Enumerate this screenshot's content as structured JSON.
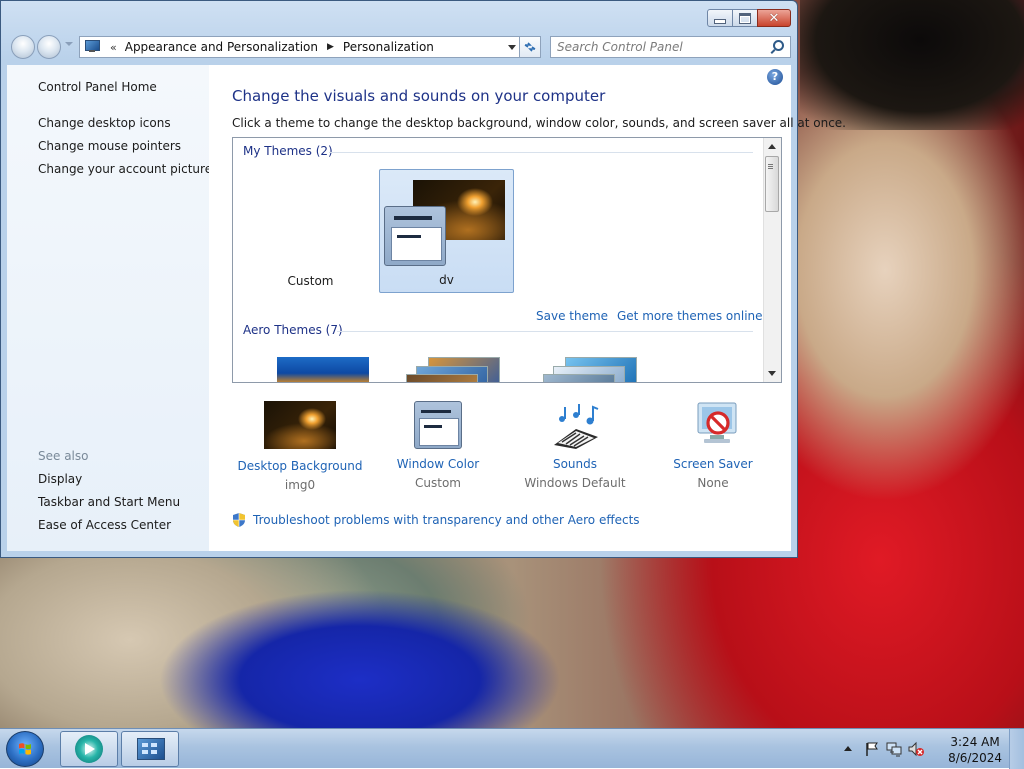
{
  "window": {
    "address": {
      "overflow_glyph": "«",
      "crumbs": [
        "Appearance and Personalization",
        "Personalization"
      ],
      "arrow": "▶"
    },
    "search": {
      "placeholder": "Search Control Panel"
    },
    "caption": {
      "close_glyph": "✕"
    }
  },
  "sidebar": {
    "home": "Control Panel Home",
    "tasks": [
      "Change desktop icons",
      "Change mouse pointers",
      "Change your account picture"
    ],
    "see_also_label": "See also",
    "see_also": [
      "Display",
      "Taskbar and Start Menu",
      "Ease of Access Center"
    ]
  },
  "content": {
    "help_glyph": "?",
    "title": "Change the visuals and sounds on your computer",
    "subtitle": "Click a theme to change the desktop background, window color, sounds, and screen saver all at once.",
    "my_themes_label": "My Themes (2)",
    "themes": [
      {
        "name": "Custom",
        "selected": false
      },
      {
        "name": "dv",
        "selected": true
      }
    ],
    "save_theme": "Save theme",
    "get_more": "Get more themes online",
    "aero_themes_label": "Aero Themes (7)",
    "settings": [
      {
        "label": "Desktop Background",
        "value": "img0",
        "icon": "desktop-background-icon"
      },
      {
        "label": "Window Color",
        "value": "Custom",
        "icon": "window-color-icon"
      },
      {
        "label": "Sounds",
        "value": "Windows Default",
        "icon": "sounds-icon"
      },
      {
        "label": "Screen Saver",
        "value": "None",
        "icon": "screen-saver-icon"
      }
    ],
    "troubleshoot": "Troubleshoot problems with transparency and other Aero effects"
  },
  "taskbar": {
    "time": "3:24 AM",
    "date": "8/6/2024"
  },
  "colors": {
    "link": "#1f63b5",
    "heading": "#1e3287",
    "selected_tile": "#c9ddf4",
    "close_button": "#c9442d"
  }
}
